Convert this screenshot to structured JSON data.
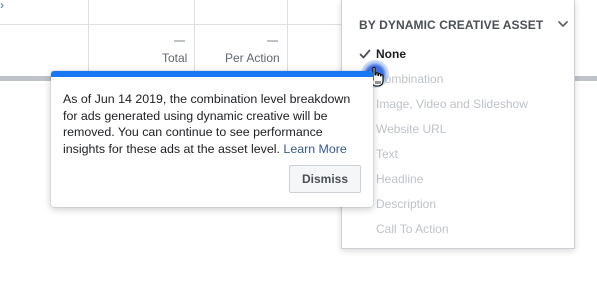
{
  "table": {
    "columns": [
      {
        "label": "Total",
        "value": "—"
      },
      {
        "label": "Per Action",
        "value": "—"
      }
    ],
    "link_glyph": "›"
  },
  "breakdown_menu": {
    "header": "BY DYNAMIC CREATIVE ASSET",
    "selected": "None",
    "items": [
      {
        "label": "None",
        "selected": true
      },
      {
        "label": "Combination",
        "selected": false
      },
      {
        "label": "Image, Video and Slideshow",
        "selected": false
      },
      {
        "label": "Website URL",
        "selected": false
      },
      {
        "label": "Text",
        "selected": false
      },
      {
        "label": "Headline",
        "selected": false
      },
      {
        "label": "Description",
        "selected": false
      },
      {
        "label": "Call To Action",
        "selected": false
      }
    ]
  },
  "notice": {
    "message": "As of Jun 14 2019, the combination level breakdown for ads generated using dynamic creative will be removed. You can continue to see performance insights for these ads at the asset level.",
    "link_label": "Learn More",
    "dismiss_label": "Dismiss"
  },
  "colors": {
    "accent_bar": "#1877f2",
    "link": "#385898",
    "disabled_text": "#bec3c9"
  }
}
